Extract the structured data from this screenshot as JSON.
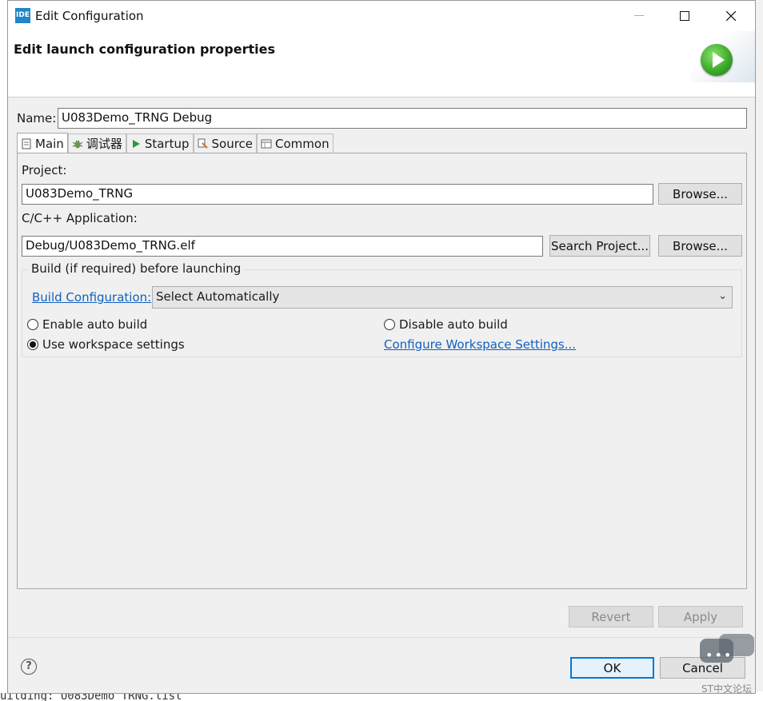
{
  "window": {
    "app_icon_text": "IDE",
    "title": "Edit Configuration",
    "header_title": "Edit launch configuration properties"
  },
  "config": {
    "name_label": "Name:",
    "name_value": "U083Demo_TRNG Debug"
  },
  "tabs": [
    {
      "label": "Main",
      "icon": "main-tab-icon",
      "active": true
    },
    {
      "label": "调试器",
      "icon": "debugger-icon",
      "active": false
    },
    {
      "label": "Startup",
      "icon": "startup-icon",
      "active": false
    },
    {
      "label": "Source",
      "icon": "source-icon",
      "active": false
    },
    {
      "label": "Common",
      "icon": "common-icon",
      "active": false
    }
  ],
  "main": {
    "project_label": "Project:",
    "project_value": "U083Demo_TRNG",
    "browse_label": "Browse...",
    "app_label": "C/C++ Application:",
    "app_value": "Debug/U083Demo_TRNG.elf",
    "search_project_label": "Search Project...",
    "browse2_label": "Browse...",
    "build_group_title": "Build (if required) before launching",
    "build_config_link": "Build Configuration:",
    "build_config_value": "Select Automatically",
    "radio_enable": "Enable auto build",
    "radio_disable": "Disable auto build",
    "radio_workspace": "Use workspace settings",
    "configure_link": "Configure Workspace Settings...",
    "selected_radio": "Use workspace settings"
  },
  "actions": {
    "revert": "Revert",
    "apply": "Apply",
    "ok": "OK",
    "cancel": "Cancel"
  },
  "background": {
    "bottom_text": "uilding: U083Demo_TRNG.list"
  },
  "watermark": {
    "text": "ST中文论坛"
  },
  "colors": {
    "link": "#1060c0",
    "accent": "#0078d7",
    "run_icon": "#3eaa2c"
  }
}
